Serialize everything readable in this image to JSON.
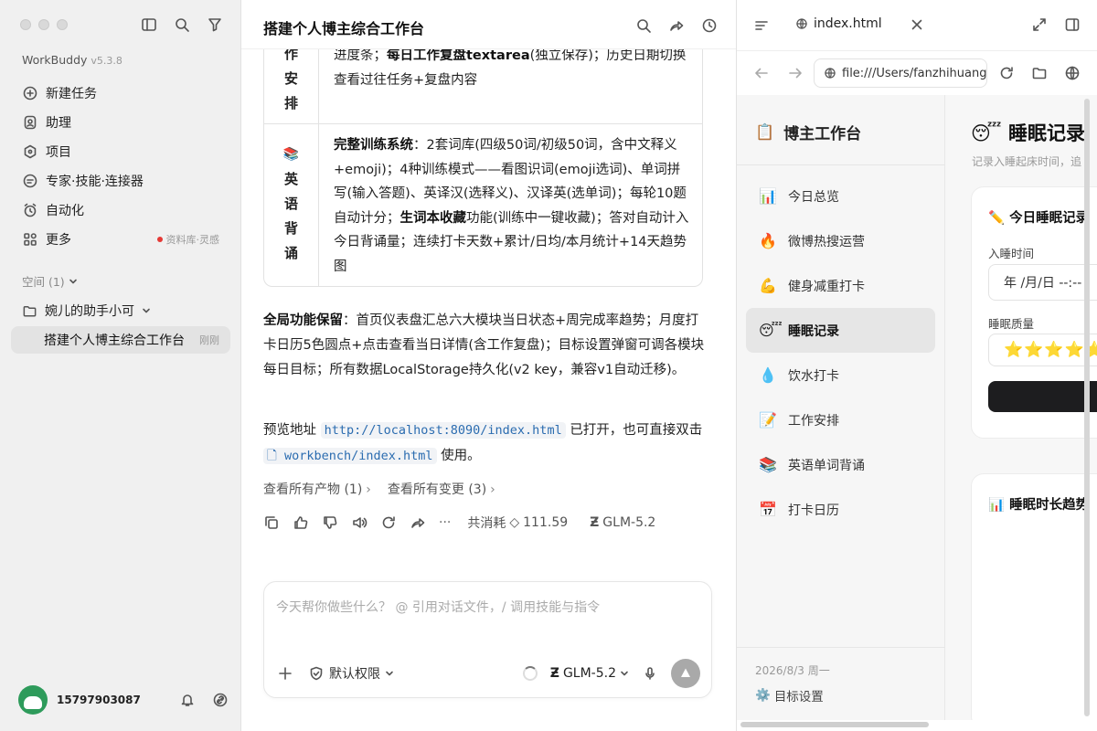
{
  "sidebar": {
    "app_name": "WorkBuddy",
    "version": "v5.3.8",
    "nav": [
      {
        "label": "新建任务",
        "icon": "plus-circle-icon"
      },
      {
        "label": "助理",
        "icon": "assistant-icon"
      },
      {
        "label": "项目",
        "icon": "project-icon"
      },
      {
        "label": "专家·技能·连接器",
        "icon": "expert-icon"
      },
      {
        "label": "自动化",
        "icon": "alarm-clock-icon"
      },
      {
        "label": "更多",
        "icon": "grid-icon",
        "badge": "资料库·灵感"
      }
    ],
    "space_label": "空间 (1)",
    "folder_label": "婉儿的助手小可",
    "active_task": "搭建个人博主综合工作台",
    "active_task_time": "刚刚",
    "user_id": "15797903087"
  },
  "chat": {
    "title": "搭建个人博主综合工作台",
    "row1_head": "作安排",
    "row1_line1_a": "进度条；",
    "row1_line1_b": "每日工作复盘textarea",
    "row1_line1_c": "(独立保存)；历史日期切换",
    "row1_line2": "查看过往任务+复盘内容",
    "row2_emoji": "📚",
    "row2_head": "英语背诵",
    "row2_b1": "完整训练系统",
    "row2_t1": "：2套词库(四级50词/初级50词，含中文释义+emoji)；4种训练模式——看图识词(emoji选词)、单词拼写(输入答题)、英译汉(选释义)、汉译英(选单词)；每轮10题自动计分；",
    "row2_b2": "生词本收藏",
    "row2_t2": "功能(训练中一键收藏)；答对自动计入今日背诵量；连续打卡天数+累计/日均/本月统计+14天趋势图",
    "para1_b": "全局功能保留",
    "para1_t": "：首页仪表盘汇总六大模块当日状态+周完成率趋势；月度打卡日历5色圆点+点击查看当日详情(含工作复盘)；目标设置弹窗可调各模块每日目标；所有数据LocalStorage持久化(v2 key，兼容v1自动迁移)。",
    "para2_a": "预览地址",
    "para2_url": "http://localhost:8090/index.html",
    "para2_b": "已打开，也可直接双击",
    "para2_file": "workbench/index.html",
    "para2_c": "使用。",
    "link_artifacts": "查看所有产物 (1)",
    "link_changes": "查看所有变更 (3)",
    "consume_label": "共消耗",
    "consume_value": "111.59",
    "model_name": "GLM-5.2",
    "composer_placeholder": "今天帮你做些什么？ @ 引用对话文件，/ 调用技能与指令",
    "permission": "默认权限",
    "composer_model": "GLM-5.2"
  },
  "preview": {
    "tab_title": "index.html",
    "url": "file:///Users/fanzhihuang",
    "site_brand": "博主工作台",
    "site_brand_emoji": "📋",
    "site_nav": [
      {
        "emoji": "📊",
        "label": "今日总览"
      },
      {
        "emoji": "🔥",
        "label": "微博热搜运营"
      },
      {
        "emoji": "💪",
        "label": "健身减重打卡"
      },
      {
        "emoji": "😴",
        "label": "睡眠记录",
        "active": true
      },
      {
        "emoji": "💧",
        "label": "饮水打卡"
      },
      {
        "emoji": "📝",
        "label": "工作安排"
      },
      {
        "emoji": "📚",
        "label": "英语单词背诵"
      },
      {
        "emoji": "📅",
        "label": "打卡日历"
      }
    ],
    "site_date": "2026/8/3 周一",
    "site_goal": "目标设置",
    "page_title": "😴 睡眠记录",
    "page_sub": "记录入睡起床时间，追",
    "card1_title": "✏️ 今日睡眠记录",
    "sleep_time_label": "入睡时间",
    "sleep_time_value": "年 /月/日 --:--",
    "quality_label": "睡眠质量",
    "quality_stars": "⭐⭐⭐⭐⭐",
    "card2_title": "📊 睡眠时长趋势"
  }
}
